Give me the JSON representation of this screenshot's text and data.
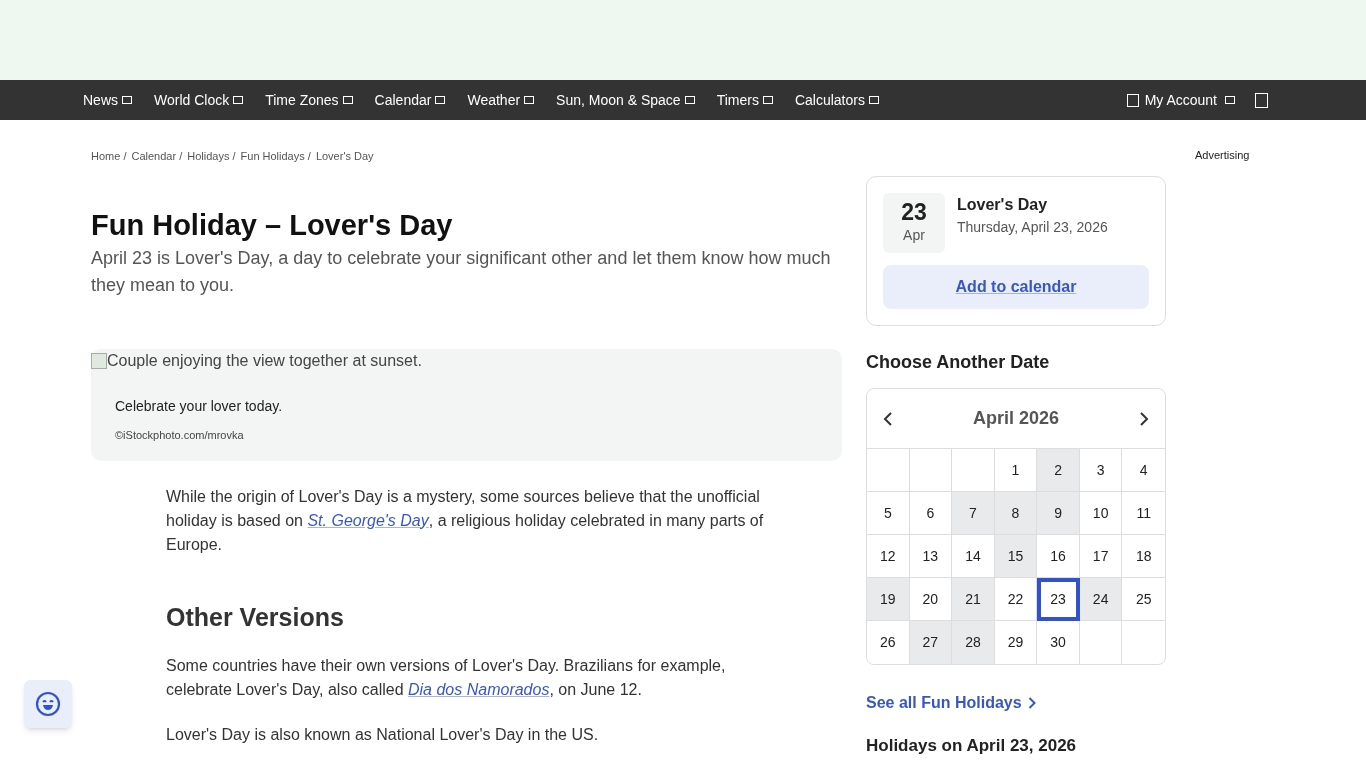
{
  "nav": {
    "items": [
      {
        "label": "News"
      },
      {
        "label": "World Clock"
      },
      {
        "label": "Time Zones"
      },
      {
        "label": "Calendar"
      },
      {
        "label": "Weather"
      },
      {
        "label": "Sun, Moon & Space"
      },
      {
        "label": "Timers"
      },
      {
        "label": "Calculators"
      }
    ],
    "account": "My Account"
  },
  "breadcrumbs": [
    "Home",
    "Calendar",
    "Holidays",
    "Fun Holidays",
    "Lover's Day"
  ],
  "breadcrumb_separator": "/",
  "advertising": "Advertising",
  "title": "Fun Holiday – Lover's Day",
  "intro": "April 23 is Lover's Day, a day to celebrate your significant other and let them know how much they mean to you.",
  "figure": {
    "alt": "Couple enjoying the view together at sunset.",
    "caption": "Celebrate your lover today.",
    "credit": "©iStockphoto.com/mrovka"
  },
  "body": [
    {
      "kind": "paragraph",
      "before": "While the origin of Lover's Day is a mystery, some sources believe that the unofficial holiday is based on ",
      "link": "St. George's Day",
      "after": ", a religious holiday celebrated in many parts of Europe."
    },
    {
      "kind": "heading",
      "text": "Other Versions"
    },
    {
      "kind": "paragraph",
      "before": "Some countries have their own versions of Lover's Day. Brazilians for example, celebrate Lover's Day, also called ",
      "link": "Dia dos Namorados",
      "after": ", on June 12."
    },
    {
      "kind": "paragraph",
      "before": "Lover's Day is also known as National Lover's Day in the US."
    }
  ],
  "event_card": {
    "day": "23",
    "month": "Apr",
    "name": "Lover's Day",
    "date": "Thursday, April 23, 2026",
    "button": "Add to calendar"
  },
  "calendar": {
    "heading": "Choose Another Date",
    "month": "April 2026",
    "weeks": [
      [
        {
          "kind": "blank"
        },
        {
          "kind": "blank"
        },
        {
          "kind": "blank"
        },
        {
          "kind": "day",
          "day": "1",
          "highlighted": false,
          "selected": false
        },
        {
          "kind": "day",
          "day": "2",
          "highlighted": true,
          "selected": false
        },
        {
          "kind": "day",
          "day": "3",
          "highlighted": false,
          "selected": false
        },
        {
          "kind": "day",
          "day": "4",
          "highlighted": false,
          "selected": false
        }
      ],
      [
        {
          "kind": "day",
          "day": "5",
          "highlighted": false,
          "selected": false
        },
        {
          "kind": "day",
          "day": "6",
          "highlighted": false,
          "selected": false
        },
        {
          "kind": "day",
          "day": "7",
          "highlighted": true,
          "selected": false
        },
        {
          "kind": "day",
          "day": "8",
          "highlighted": true,
          "selected": false
        },
        {
          "kind": "day",
          "day": "9",
          "highlighted": true,
          "selected": false
        },
        {
          "kind": "day",
          "day": "10",
          "highlighted": false,
          "selected": false
        },
        {
          "kind": "day",
          "day": "11",
          "highlighted": false,
          "selected": false
        }
      ],
      [
        {
          "kind": "day",
          "day": "12",
          "highlighted": false,
          "selected": false
        },
        {
          "kind": "day",
          "day": "13",
          "highlighted": false,
          "selected": false
        },
        {
          "kind": "day",
          "day": "14",
          "highlighted": false,
          "selected": false
        },
        {
          "kind": "day",
          "day": "15",
          "highlighted": true,
          "selected": false
        },
        {
          "kind": "day",
          "day": "16",
          "highlighted": false,
          "selected": false
        },
        {
          "kind": "day",
          "day": "17",
          "highlighted": false,
          "selected": false
        },
        {
          "kind": "day",
          "day": "18",
          "highlighted": false,
          "selected": false
        }
      ],
      [
        {
          "kind": "day",
          "day": "19",
          "highlighted": true,
          "selected": false
        },
        {
          "kind": "day",
          "day": "20",
          "highlighted": false,
          "selected": false
        },
        {
          "kind": "day",
          "day": "21",
          "highlighted": true,
          "selected": false
        },
        {
          "kind": "day",
          "day": "22",
          "highlighted": false,
          "selected": false
        },
        {
          "kind": "day",
          "day": "23",
          "highlighted": false,
          "selected": true
        },
        {
          "kind": "day",
          "day": "24",
          "highlighted": true,
          "selected": false
        },
        {
          "kind": "day",
          "day": "25",
          "highlighted": false,
          "selected": false
        }
      ],
      [
        {
          "kind": "day",
          "day": "26",
          "highlighted": false,
          "selected": false
        },
        {
          "kind": "day",
          "day": "27",
          "highlighted": true,
          "selected": false
        },
        {
          "kind": "day",
          "day": "28",
          "highlighted": true,
          "selected": false
        },
        {
          "kind": "day",
          "day": "29",
          "highlighted": false,
          "selected": false
        },
        {
          "kind": "day",
          "day": "30",
          "highlighted": false,
          "selected": false
        },
        {
          "kind": "blank"
        },
        {
          "kind": "blank"
        }
      ]
    ]
  },
  "see_all": "See all Fun Holidays",
  "holidays_heading": "Holidays on April 23, 2026"
}
